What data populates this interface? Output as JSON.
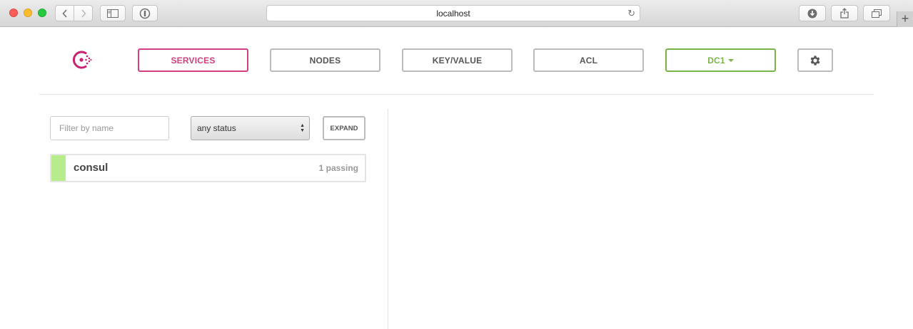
{
  "browser": {
    "url": "localhost"
  },
  "nav": {
    "services": "SERVICES",
    "nodes": "NODES",
    "keyvalue": "KEY/VALUE",
    "acl": "ACL",
    "datacenter": "DC1"
  },
  "filters": {
    "name_placeholder": "Filter by name",
    "status_selected": "any status",
    "expand_label": "EXPAND"
  },
  "services": [
    {
      "name": "consul",
      "status": "1 passing",
      "status_color": "#b7ec8c"
    }
  ],
  "colors": {
    "services_accent": "#d23e81",
    "datacenter_accent": "#79b448"
  },
  "icons": [
    "consul-logo",
    "gear-icon",
    "caret-down-icon",
    "sidebar-icon",
    "shield-icon",
    "reload-icon",
    "download-icon",
    "share-icon",
    "tabs-icon"
  ]
}
